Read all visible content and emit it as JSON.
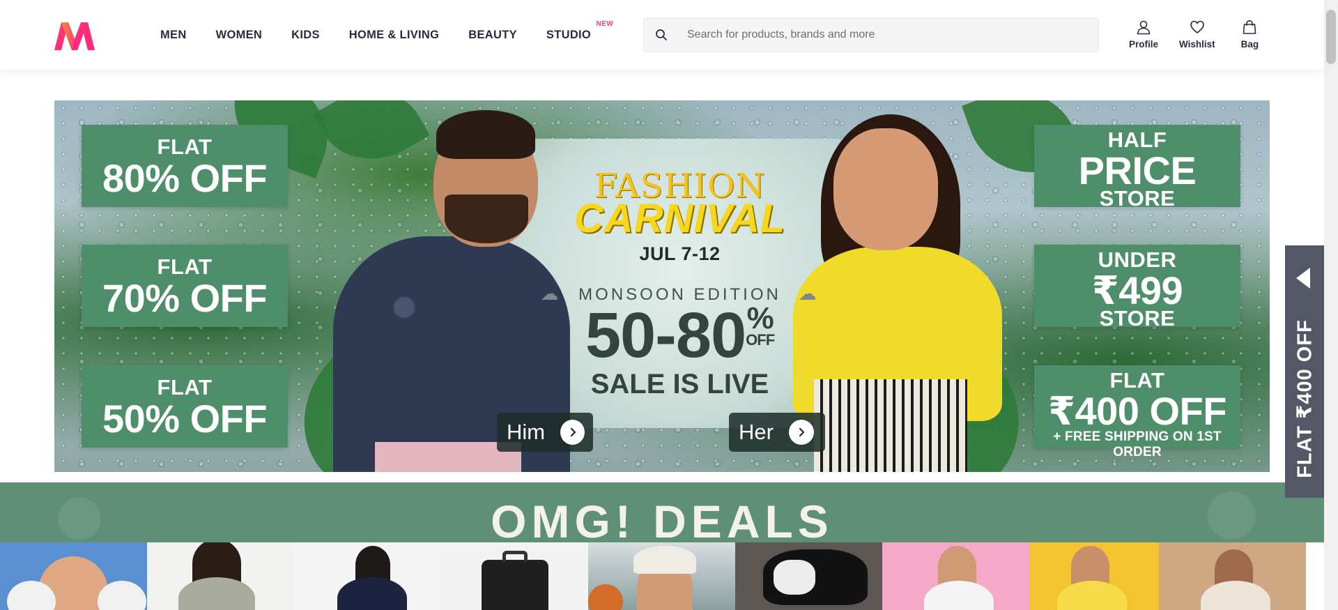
{
  "header": {
    "nav": [
      "MEN",
      "WOMEN",
      "KIDS",
      "HOME & LIVING",
      "BEAUTY",
      "STUDIO"
    ],
    "studio_badge": "NEW",
    "search_placeholder": "Search for products, brands and more",
    "actions": {
      "profile": "Profile",
      "wishlist": "Wishlist",
      "bag": "Bag"
    }
  },
  "hero": {
    "left_offers": [
      {
        "small": "FLAT",
        "big": "80% OFF"
      },
      {
        "small": "FLAT",
        "big": "70% OFF"
      },
      {
        "small": "FLAT",
        "big": "50% OFF"
      }
    ],
    "right_offers": [
      {
        "small": "HALF",
        "big": "PRICE",
        "bottom": "STORE"
      },
      {
        "small": "UNDER",
        "big": "₹499",
        "bottom": "STORE"
      },
      {
        "small": "FLAT",
        "big": "₹400 OFF",
        "bottom": "+ FREE SHIPPING ON 1ST ORDER"
      }
    ],
    "event_line1": "FASHION",
    "event_line2": "CARNIVAL",
    "dates": "JUL 7-12",
    "edition": "MONSOON EDITION",
    "discount_range": "50-80",
    "discount_pct": "%",
    "discount_off": "OFF",
    "sale_status": "SALE IS LIVE",
    "cta_him": "Him",
    "cta_her": "Her"
  },
  "side_tab": {
    "label": "FLAT ₹400 OFF"
  },
  "deals": {
    "title": "OMG! DEALS"
  },
  "colors": {
    "brand_pink": "#ff3f6c",
    "promo_green": "#4f8e6a",
    "deals_green": "#5f8f76",
    "side_tab": "#535766"
  }
}
